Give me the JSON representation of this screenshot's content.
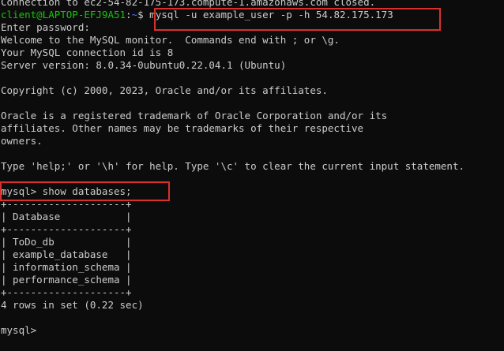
{
  "terminal": {
    "lines": {
      "connection_closed": "Connection to ec2-54-82-175-173.compute-1.amazonaws.com closed.",
      "prompt_user": "client@LAPTOP-EFJ9A51",
      "prompt_sep": ":",
      "prompt_path": "~",
      "prompt_symbol": "$ ",
      "mysql_command": "mysql -u example_user -p -h 54.82.175.173",
      "enter_password": "Enter password:",
      "welcome": "Welcome to the MySQL monitor.  Commands end with ; or \\g.",
      "connection_id": "Your MySQL connection id is 8",
      "server_version": "Server version: 8.0.34-0ubuntu0.22.04.1 (Ubuntu)",
      "copyright": "Copyright (c) 2000, 2023, Oracle and/or its affiliates.",
      "trademark_1": "Oracle is a registered trademark of Oracle Corporation and/or its",
      "trademark_2": "affiliates. Other names may be trademarks of their respective",
      "trademark_3": "owners.",
      "help_hint": "Type 'help;' or '\\h' for help. Type '\\c' to clear the current input statement.",
      "show_db_command": "mysql> show databases;",
      "border_top": "+--------------------+",
      "header_row": "| Database           |",
      "border_mid": "+--------------------+",
      "row_1": "| ToDo_db            |",
      "row_2": "| example_database   |",
      "row_3": "| information_schema |",
      "row_4": "| performance_schema |",
      "border_bottom": "+--------------------+",
      "rows_count": "4 rows in set (0.22 sec)",
      "final_prompt": "mysql>"
    },
    "highlight_color": "#d9302c",
    "prompt_user_color": "#16c60c",
    "prompt_path_color": "#3b78ff"
  }
}
